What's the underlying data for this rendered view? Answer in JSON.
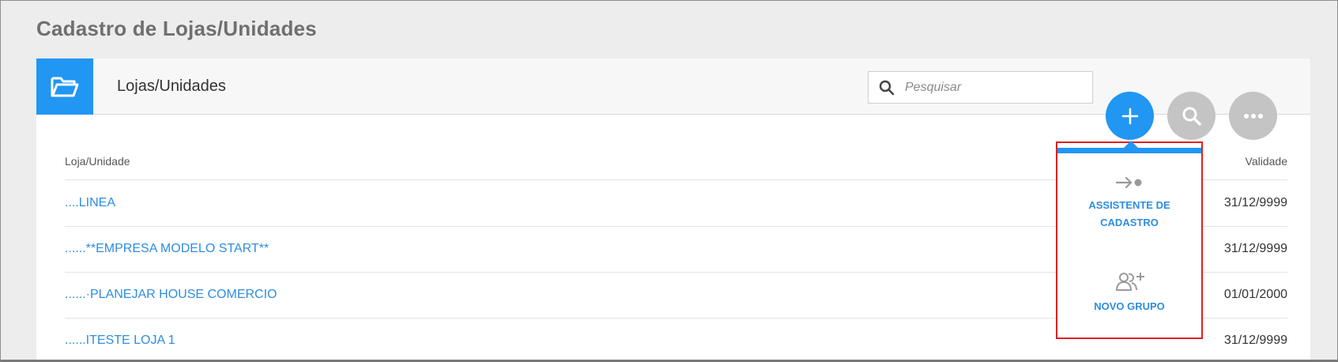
{
  "page": {
    "title": "Cadastro de Lojas/Unidades"
  },
  "panel": {
    "title": "Lojas/Unidades",
    "icon": "folder-open-icon",
    "search": {
      "placeholder": "Pesquisar",
      "icon": "search-icon"
    }
  },
  "table": {
    "columns": [
      "Loja/Unidade",
      "Validade"
    ],
    "rows": [
      {
        "name": "....LINEA",
        "validade": "31/12/9999"
      },
      {
        "name": "......**EMPRESA MODELO  START**",
        "validade": "31/12/9999"
      },
      {
        "name": "......·PLANEJAR HOUSE COMERCIO",
        "validade": "01/01/2000"
      },
      {
        "name": "......ITESTE LOJA 1",
        "validade": "31/12/9999"
      }
    ]
  },
  "fabs": {
    "add": {
      "icon": "plus-icon",
      "color": "#2196f3"
    },
    "search": {
      "icon": "search-icon",
      "color": "#c4c4c4"
    },
    "more": {
      "icon": "more-horizontal-icon",
      "color": "#c4c4c4"
    }
  },
  "dropdown": {
    "items": [
      {
        "label": "ASSISTENTE DE CADASTRO",
        "icon": "arrow-to-dot-icon"
      },
      {
        "label": "NOVO GRUPO",
        "icon": "add-group-icon"
      }
    ],
    "highlight_color": "#e02020",
    "accent_color": "#2196f3"
  }
}
